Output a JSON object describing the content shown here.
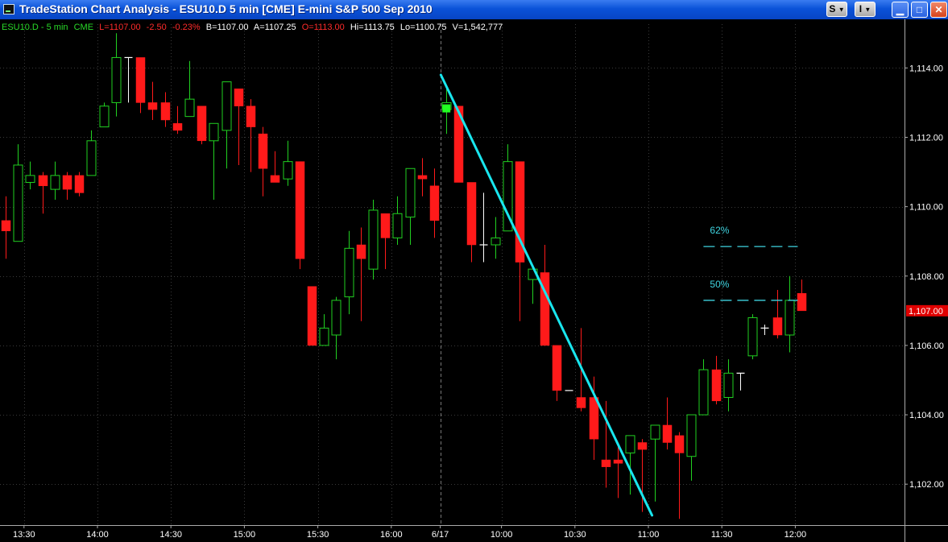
{
  "window": {
    "title": "TradeStation Chart Analysis - ESU10.D 5 min [CME] E-mini S&P 500 Sep 2010",
    "buttons": {
      "s_label": "S",
      "i_label": "I",
      "minimize": "▁",
      "maximize": "□",
      "close": "✕"
    }
  },
  "symbol_bar": {
    "symbol": "ESU10.D - 5 min",
    "exchange": "CME",
    "last": "L=1107.00",
    "change": "-2.50",
    "change_pct": "-0.23%",
    "bid": "B=1107.00",
    "ask": "A=1107.25",
    "open": "O=1113.00",
    "high": "Hi=1113.75",
    "low": "Lo=1100.75",
    "volume": "V=1,542,777"
  },
  "colors": {
    "up": "#21d021",
    "down": "#ff1a1a",
    "neutral": "#ffffff",
    "trendline": "#19e6ee",
    "fib": "#3fd4e0",
    "grid": "#3a3a3a",
    "last_price_bg": "#e00000"
  },
  "chart_data": {
    "type": "candlestick",
    "y_ticks": [
      "1,114.00",
      "1,112.00",
      "1,110.00",
      "1,108.00",
      "1,106.00",
      "1,104.00",
      "1,102.00"
    ],
    "y_tick_values": [
      1114,
      1112,
      1110,
      1108,
      1106,
      1104,
      1102
    ],
    "ylim": [
      1100.82,
      1115.03
    ],
    "x_ticks": [
      "13:30",
      "14:00",
      "14:30",
      "15:00",
      "15:30",
      "16:00",
      "6/17",
      "10:00",
      "10:30",
      "11:00",
      "11:30",
      "12:00"
    ],
    "x_tick_bars": [
      1.5,
      7.5,
      13.5,
      19.5,
      25.5,
      31.5,
      35.5,
      40.5,
      46.5,
      52.5,
      58.5,
      64.5
    ],
    "session_break_bar": 35.5,
    "last_price": 1107,
    "last_price_label": "1,107.00",
    "candles": [
      {
        "o": 1109.6,
        "h": 1110.3,
        "l": 1108.5,
        "c": 1109.3
      },
      {
        "o": 1109,
        "h": 1111.8,
        "l": 1109,
        "c": 1111.2
      },
      {
        "o": 1110.7,
        "h": 1111.3,
        "l": 1110.5,
        "c": 1110.9
      },
      {
        "o": 1110.9,
        "h": 1111,
        "l": 1109.8,
        "c": 1110.6
      },
      {
        "o": 1110.5,
        "h": 1111.3,
        "l": 1110.2,
        "c": 1110.9
      },
      {
        "o": 1110.9,
        "h": 1111,
        "l": 1110.2,
        "c": 1110.5
      },
      {
        "o": 1110.9,
        "h": 1111,
        "l": 1110.3,
        "c": 1110.4
      },
      {
        "o": 1110.9,
        "h": 1112.2,
        "l": 1110.9,
        "c": 1111.9
      },
      {
        "o": 1112.3,
        "h": 1113,
        "l": 1112.3,
        "c": 1112.9
      },
      {
        "o": 1113,
        "h": 1115,
        "l": 1112.6,
        "c": 1114.3
      },
      {
        "o": 1114.3,
        "h": 1114.3,
        "l": 1113,
        "c": 1114.3
      },
      {
        "o": 1114.3,
        "h": 1114.3,
        "l": 1112.7,
        "c": 1113
      },
      {
        "o": 1113,
        "h": 1113.6,
        "l": 1112.5,
        "c": 1112.8
      },
      {
        "o": 1113,
        "h": 1113.3,
        "l": 1112.3,
        "c": 1112.5
      },
      {
        "o": 1112.4,
        "h": 1112.9,
        "l": 1112.1,
        "c": 1112.2
      },
      {
        "o": 1112.6,
        "h": 1114.2,
        "l": 1112.6,
        "c": 1113.1
      },
      {
        "o": 1112.9,
        "h": 1112.9,
        "l": 1111.8,
        "c": 1111.9
      },
      {
        "o": 1111.9,
        "h": 1112.4,
        "l": 1110.2,
        "c": 1112.4
      },
      {
        "o": 1112.2,
        "h": 1113.6,
        "l": 1111.1,
        "c": 1113.6
      },
      {
        "o": 1113.4,
        "h": 1113.4,
        "l": 1111.2,
        "c": 1112.9
      },
      {
        "o": 1112.9,
        "h": 1113.1,
        "l": 1111,
        "c": 1112.3
      },
      {
        "o": 1112.1,
        "h": 1112.3,
        "l": 1110.3,
        "c": 1111.1
      },
      {
        "o": 1110.9,
        "h": 1111.6,
        "l": 1110.8,
        "c": 1110.7
      },
      {
        "o": 1110.8,
        "h": 1111.9,
        "l": 1110.6,
        "c": 1111.3
      },
      {
        "o": 1111.3,
        "h": 1111.3,
        "l": 1108.2,
        "c": 1108.5
      },
      {
        "o": 1107.7,
        "h": 1107.7,
        "l": 1106,
        "c": 1106
      },
      {
        "o": 1106,
        "h": 1106.9,
        "l": 1106,
        "c": 1106.5
      },
      {
        "o": 1106.3,
        "h": 1107.4,
        "l": 1105.6,
        "c": 1107.3
      },
      {
        "o": 1107.4,
        "h": 1109.3,
        "l": 1106.9,
        "c": 1108.8
      },
      {
        "o": 1108.9,
        "h": 1109.4,
        "l": 1106.7,
        "c": 1108.5
      },
      {
        "o": 1108.2,
        "h": 1110.2,
        "l": 1107.9,
        "c": 1109.9
      },
      {
        "o": 1109.8,
        "h": 1109.8,
        "l": 1108.2,
        "c": 1109.1
      },
      {
        "o": 1109.1,
        "h": 1110.3,
        "l": 1108.9,
        "c": 1109.8
      },
      {
        "o": 1109.7,
        "h": 1110.8,
        "l": 1108.9,
        "c": 1111.1
      },
      {
        "o": 1110.9,
        "h": 1111.4,
        "l": 1110.3,
        "c": 1110.8
      },
      {
        "o": 1110.6,
        "h": 1111.1,
        "l": 1109.1,
        "c": 1109.6
      },
      {
        "o": 1112.8,
        "h": 1113.5,
        "l": 1112.1,
        "c": 1113
      },
      {
        "o": 1112.9,
        "h": 1112.9,
        "l": 1110.7,
        "c": 1110.7
      },
      {
        "o": 1110.7,
        "h": 1110.7,
        "l": 1108.4,
        "c": 1108.9
      },
      {
        "o": 1108.9,
        "h": 1110.4,
        "l": 1108.4,
        "c": 1108.9
      },
      {
        "o": 1108.9,
        "h": 1109.7,
        "l": 1108.5,
        "c": 1109.1
      },
      {
        "o": 1109.3,
        "h": 1111.8,
        "l": 1109.3,
        "c": 1111.3
      },
      {
        "o": 1111.3,
        "h": 1111.3,
        "l": 1106.7,
        "c": 1108.4
      },
      {
        "o": 1107.9,
        "h": 1108.3,
        "l": 1107.2,
        "c": 1108.2
      },
      {
        "o": 1108.1,
        "h": 1108.9,
        "l": 1106.6,
        "c": 1106
      },
      {
        "o": 1106,
        "h": 1106,
        "l": 1104.4,
        "c": 1104.7
      },
      {
        "o": 1104.7,
        "h": 1104.7,
        "l": 1104.7,
        "c": 1104.7
      },
      {
        "o": 1104.5,
        "h": 1106.5,
        "l": 1104.1,
        "c": 1104.2
      },
      {
        "o": 1104.5,
        "h": 1105.1,
        "l": 1102.7,
        "c": 1103.3
      },
      {
        "o": 1102.7,
        "h": 1104.4,
        "l": 1101.9,
        "c": 1102.5
      },
      {
        "o": 1102.7,
        "h": 1103.1,
        "l": 1101.6,
        "c": 1102.6
      },
      {
        "o": 1102.9,
        "h": 1103.2,
        "l": 1101.7,
        "c": 1103.4
      },
      {
        "o": 1103.2,
        "h": 1103.3,
        "l": 1101.2,
        "c": 1103
      },
      {
        "o": 1103.3,
        "h": 1103.7,
        "l": 1101.5,
        "c": 1103.7
      },
      {
        "o": 1103.7,
        "h": 1104.5,
        "l": 1103,
        "c": 1103.2
      },
      {
        "o": 1103.4,
        "h": 1103.5,
        "l": 1101,
        "c": 1102.9
      },
      {
        "o": 1102.8,
        "h": 1104,
        "l": 1102.1,
        "c": 1104
      },
      {
        "o": 1104,
        "h": 1105.6,
        "l": 1104,
        "c": 1105.3
      },
      {
        "o": 1105.3,
        "h": 1105.7,
        "l": 1104.3,
        "c": 1104.4
      },
      {
        "o": 1104.5,
        "h": 1105.6,
        "l": 1104.1,
        "c": 1105.2
      },
      {
        "o": 1105.2,
        "h": 1105.2,
        "l": 1104.7,
        "c": 1105.2
      },
      {
        "o": 1105.7,
        "h": 1106.9,
        "l": 1105.6,
        "c": 1106.8
      },
      {
        "o": 1106.5,
        "h": 1106.6,
        "l": 1106.3,
        "c": 1106.5
      },
      {
        "o": 1106.8,
        "h": 1107.6,
        "l": 1106.2,
        "c": 1106.3
      },
      {
        "o": 1106.3,
        "h": 1108,
        "l": 1105.8,
        "c": 1107.3
      },
      {
        "o": 1107.5,
        "h": 1107.9,
        "l": 1107.1,
        "c": 1107
      }
    ],
    "trendline": {
      "from": {
        "bar": 35.55,
        "price": 1113.8
      },
      "to": {
        "bar": 52.8,
        "price": 1101.1
      }
    },
    "fib_levels": [
      {
        "label": "62%",
        "price": 1108.85,
        "from_bar": 57,
        "to_bar": 64.7
      },
      {
        "label": "50%",
        "price": 1107.3,
        "from_bar": 57,
        "to_bar": 64.7
      }
    ]
  }
}
